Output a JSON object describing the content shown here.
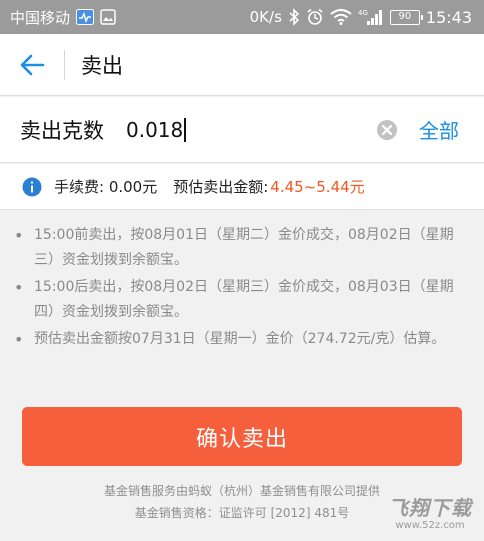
{
  "status_bar": {
    "carrier": "中国移动",
    "speed": "0K/s",
    "network": "4G",
    "battery": "90",
    "time": "15:43"
  },
  "header": {
    "title": "卖出",
    "back_icon": "arrow-left-icon"
  },
  "sell_form": {
    "label": "卖出克数",
    "value": "0.018",
    "all_label": "全部"
  },
  "fee_info": {
    "fee_text": "手续费: 0.00元",
    "estimate_label": "预估卖出金额:",
    "estimate_value": "4.45~5.44元",
    "estimate_color": "#f2571f"
  },
  "notes": [
    "15:00前卖出，按08月01日（星期二）金价成交，08月02日（星期三）资金划拨到余额宝。",
    "15:00后卖出，按08月02日（星期三）金价成交，08月03日（星期四）资金划拨到余额宝。",
    "预估卖出金额按07月31日（星期一）金价（274.72元/克）估算。"
  ],
  "confirm_button": {
    "label": "确认卖出",
    "color": "#f55f3c"
  },
  "footer": {
    "line1": "基金销售服务由蚂蚁（杭州）基金销售有限公司提供",
    "line2": "基金销售资格：证监许可 [2012] 481号"
  },
  "watermark": {
    "main": "飞翔下载",
    "url": "www.52z.com"
  },
  "accent_color": "#1a8fe3"
}
